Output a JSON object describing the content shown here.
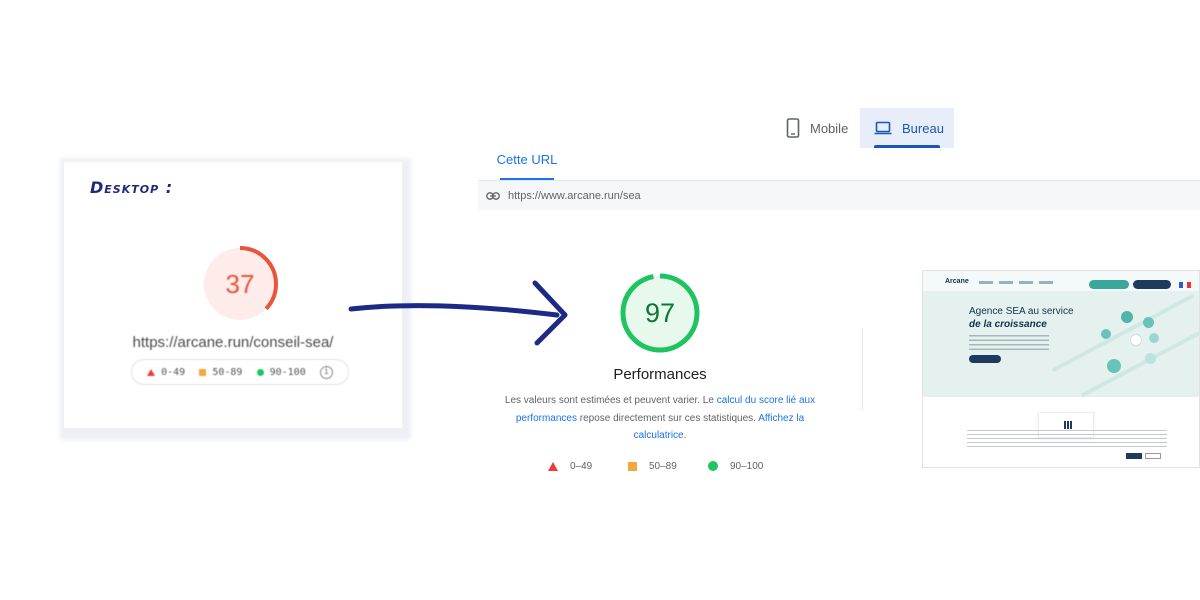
{
  "old_report": {
    "label": "Desktop :",
    "score": "37",
    "score_fraction": 0.37,
    "score_color": "#e8553a",
    "url": "https://arcane.run/conseil-sea/",
    "legend": [
      {
        "range": "0-49",
        "shape": "triangle",
        "color": "#f03a3a"
      },
      {
        "range": "50-89",
        "shape": "square",
        "color": "#f4a73a"
      },
      {
        "range": "90-100",
        "shape": "circle",
        "color": "#1ec45f"
      }
    ],
    "legend_info_icon": "info-icon"
  },
  "device_tabs": {
    "mobile": {
      "label": "Mobile",
      "icon": "smartphone-icon",
      "selected": false
    },
    "desktop": {
      "label": "Bureau",
      "icon": "laptop-icon",
      "selected": true
    }
  },
  "url_tab": {
    "label": "Cette URL"
  },
  "url_bar": {
    "icon": "link-icon",
    "url": "https://www.arcane.run/sea"
  },
  "new_report": {
    "score": "97",
    "score_fraction": 0.97,
    "score_color": "#0a7a33",
    "title": "Performances",
    "desc_1": "Les valeurs sont estimées et peuvent varier. Le ",
    "link_1": "calcul du score lié aux performances",
    "desc_2": " repose directement sur ces statistiques. ",
    "link_2": "Affichez la calculatrice",
    "desc_3": ".",
    "legend": [
      {
        "range": "0–49",
        "shape": "triangle",
        "color": "#f03a3a"
      },
      {
        "range": "50–89",
        "shape": "square",
        "color": "#f4a73a"
      },
      {
        "range": "90–100",
        "shape": "circle",
        "color": "#1ec45f"
      }
    ]
  },
  "thumbnail": {
    "logo": "Arcane",
    "heading_1": "Agence SEA au service",
    "heading_2": "de la croissance"
  },
  "colors": {
    "accent_blue": "#1a73e8",
    "arrow": "#1c2a86"
  }
}
